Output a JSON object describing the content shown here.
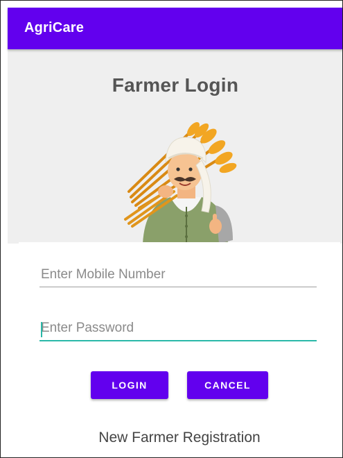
{
  "app_bar": {
    "title": "AgriCare",
    "color": "#6200ee"
  },
  "header": {
    "title": "Farmer Login"
  },
  "illustration": {
    "icon": "farmer-with-wheat-illustration"
  },
  "form": {
    "mobile": {
      "placeholder": "Enter Mobile Number",
      "value": ""
    },
    "password": {
      "placeholder": "Enter Password",
      "value": ""
    },
    "login_label": "LOGIN",
    "cancel_label": "CANCEL",
    "register_label": "New Farmer Registration"
  },
  "colors": {
    "primary": "#6200ee",
    "focus_accent": "#2ab8a8",
    "hero_background": "#efefef"
  }
}
